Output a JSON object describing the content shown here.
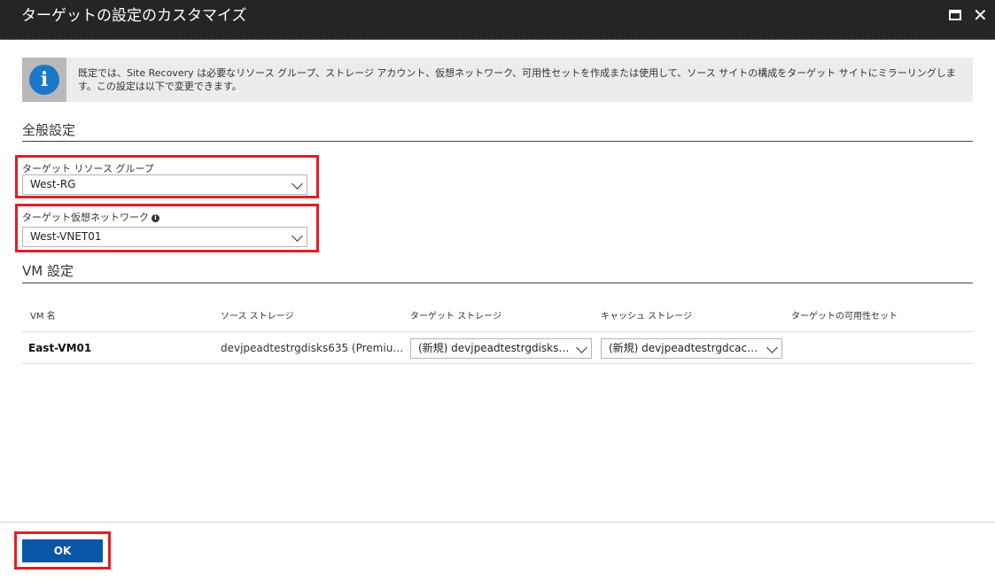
{
  "window": {
    "title": "ターゲットの設定のカスタマイズ",
    "maximize_icon": "maximize-icon",
    "close_icon": "close-icon",
    "close_glyph": "✕"
  },
  "info": {
    "icon_glyph": "i",
    "text": "既定では、Site Recovery は必要なリソース グループ、ストレージ アカウント、仮想ネットワーク、可用性セットを作成または使用して、ソース サイトの構成をターゲット サイトにミラーリングします。この設定は以下で変更できます。"
  },
  "general": {
    "title": "全般設定",
    "resource_group": {
      "label": "ターゲット リソース グループ",
      "value": "West-RG"
    },
    "virtual_network": {
      "label": "ターゲット仮想ネットワーク",
      "value": "West-VNET01",
      "info_glyph": "i"
    }
  },
  "vm": {
    "title": "VM 設定",
    "columns": [
      "VM 名",
      "ソース ストレージ",
      "ターゲット ストレージ",
      "キャッシュ ストレージ",
      "ターゲットの可用性セット"
    ],
    "rows": [
      {
        "vm_name": "East-VM01",
        "source_storage": "devjpeadtestrgdisks635 (Premiu…",
        "target_storage": "(新規) devjpeadtestrgdisks6…",
        "cache_storage": "(新規) devjpeadtestrgdcach…"
      }
    ]
  },
  "footer": {
    "ok_label": "OK"
  },
  "colors": {
    "highlight": "#e31e24",
    "primary": "#0a57a8",
    "titlebar": "#252525",
    "info_blue": "#1a78c8"
  }
}
